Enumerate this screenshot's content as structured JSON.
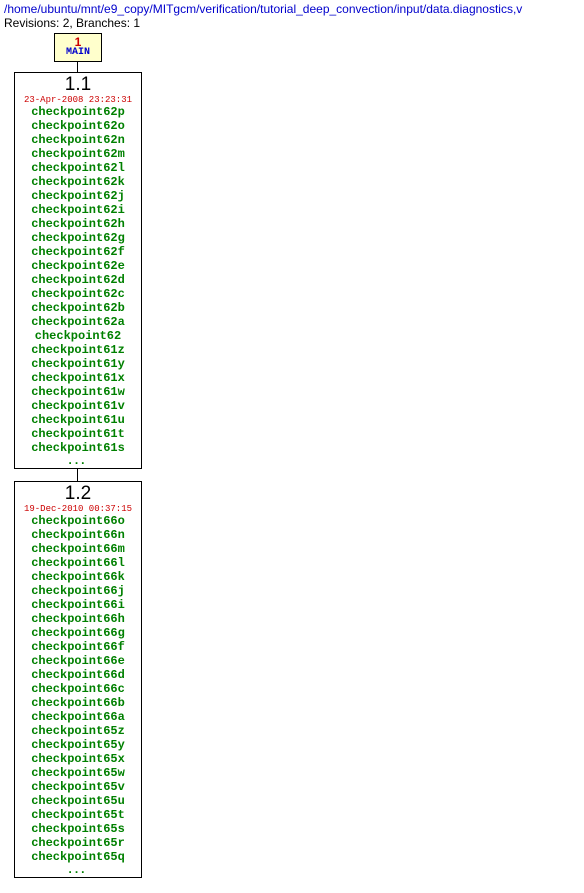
{
  "header": {
    "path": "/home/ubuntu/mnt/e9_copy/MITgcm/verification/tutorial_deep_convection/input/data.diagnostics,v",
    "meta": "Revisions: 2, Branches: 1"
  },
  "main": {
    "num": "1",
    "label": "MAIN"
  },
  "rev1": {
    "num": "1.1",
    "date": "23-Apr-2008 23:23:31",
    "tags": [
      "checkpoint62p",
      "checkpoint62o",
      "checkpoint62n",
      "checkpoint62m",
      "checkpoint62l",
      "checkpoint62k",
      "checkpoint62j",
      "checkpoint62i",
      "checkpoint62h",
      "checkpoint62g",
      "checkpoint62f",
      "checkpoint62e",
      "checkpoint62d",
      "checkpoint62c",
      "checkpoint62b",
      "checkpoint62a",
      "checkpoint62",
      "checkpoint61z",
      "checkpoint61y",
      "checkpoint61x",
      "checkpoint61w",
      "checkpoint61v",
      "checkpoint61u",
      "checkpoint61t",
      "checkpoint61s"
    ]
  },
  "rev2": {
    "num": "1.2",
    "date": "19-Dec-2010 00:37:15",
    "tags": [
      "checkpoint66o",
      "checkpoint66n",
      "checkpoint66m",
      "checkpoint66l",
      "checkpoint66k",
      "checkpoint66j",
      "checkpoint66i",
      "checkpoint66h",
      "checkpoint66g",
      "checkpoint66f",
      "checkpoint66e",
      "checkpoint66d",
      "checkpoint66c",
      "checkpoint66b",
      "checkpoint66a",
      "checkpoint65z",
      "checkpoint65y",
      "checkpoint65x",
      "checkpoint65w",
      "checkpoint65v",
      "checkpoint65u",
      "checkpoint65t",
      "checkpoint65s",
      "checkpoint65r",
      "checkpoint65q"
    ]
  },
  "ellipsis": "..."
}
